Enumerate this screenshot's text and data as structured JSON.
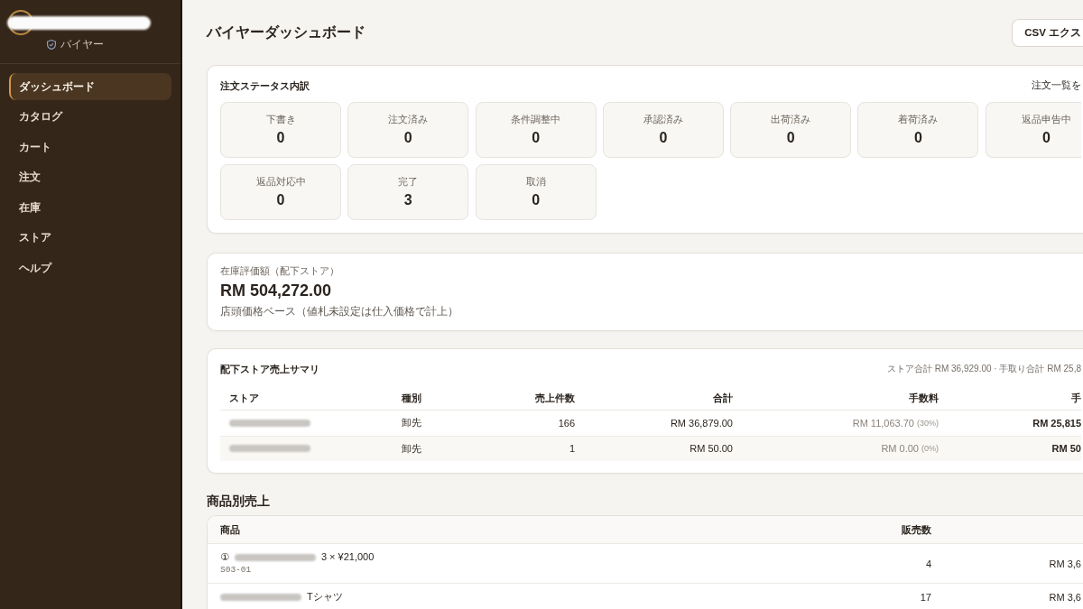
{
  "sidebar": {
    "user": {
      "role": "バイヤー"
    },
    "items": [
      {
        "label": "ダッシュボード",
        "selected": true
      },
      {
        "label": "カタログ",
        "selected": false
      },
      {
        "label": "カート",
        "selected": false
      },
      {
        "label": "注文",
        "selected": false
      },
      {
        "label": "在庫",
        "selected": false
      },
      {
        "label": "ストア",
        "selected": false
      },
      {
        "label": "ヘルプ",
        "selected": false
      }
    ]
  },
  "header": {
    "title": "バイヤーダッシュボード",
    "export_button": "CSV エクス"
  },
  "order_status": {
    "title": "注文ステータス内訳",
    "link": "注文一覧を",
    "tiles": [
      {
        "label": "下書き",
        "count": "0"
      },
      {
        "label": "注文済み",
        "count": "0"
      },
      {
        "label": "条件調整中",
        "count": "0"
      },
      {
        "label": "承認済み",
        "count": "0"
      },
      {
        "label": "出荷済み",
        "count": "0"
      },
      {
        "label": "着荷済み",
        "count": "0"
      },
      {
        "label": "返品申告中",
        "count": "0"
      },
      {
        "label": "返品対応中",
        "count": "0"
      },
      {
        "label": "完了",
        "count": "3"
      },
      {
        "label": "取消",
        "count": "0"
      }
    ]
  },
  "inventory": {
    "label": "在庫評価額（配下ストア）",
    "value": "RM 504,272.00",
    "note": "店頭価格ベース（値札未設定は仕入価格で計上）"
  },
  "store_sales": {
    "title": "配下ストア売上サマリ",
    "totals": "ストア合計 RM 36,929.00 · 手取り合計 RM 25,8",
    "columns": [
      "ストア",
      "種別",
      "売上件数",
      "合計",
      "手数料",
      "手"
    ],
    "rows": [
      {
        "store": [
          {
            "kind": "redacted"
          }
        ],
        "type": "卸先",
        "count": "166",
        "total": "RM 36,879.00",
        "fee": "RM 11,063.70",
        "fee_rate": "(30%)",
        "net": "RM 25,815"
      },
      {
        "store": [
          {
            "kind": "redacted"
          }
        ],
        "type": "卸先",
        "count": "1",
        "total": "RM 50.00",
        "fee": "RM 0.00",
        "fee_rate": "(0%)",
        "net": "RM 50"
      }
    ]
  },
  "product_sales": {
    "title": "商品別売上",
    "columns": [
      "商品",
      "販売数"
    ],
    "rows": [
      {
        "name": [
          {
            "kind": "text",
            "text": "①"
          },
          {
            "kind": "redacted"
          },
          {
            "kind": "text",
            "text": "3 × ¥21,000"
          }
        ],
        "sku": "S03-01",
        "sold": "4",
        "column_3": "RM 3,6"
      },
      {
        "name": [
          {
            "kind": "redacted"
          },
          {
            "kind": "text",
            "text": "Tシャツ"
          }
        ],
        "sold": "17",
        "column_3": "RM 3,6"
      }
    ]
  }
}
